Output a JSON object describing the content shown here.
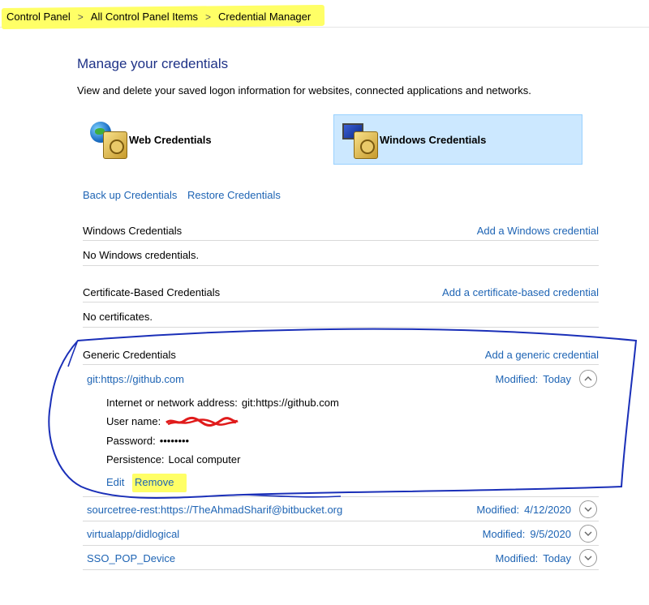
{
  "breadcrumb": {
    "items": [
      "Control Panel",
      "All Control Panel Items",
      "Credential Manager"
    ],
    "separator": ">"
  },
  "page": {
    "title": "Manage your credentials",
    "description": "View and delete your saved logon information for websites, connected applications and networks."
  },
  "tiles": {
    "web": {
      "label": "Web Credentials",
      "icon": "globe-vault-icon"
    },
    "windows": {
      "label": "Windows Credentials",
      "icon": "monitor-vault-icon",
      "selected": true
    }
  },
  "links": {
    "backup": "Back up Credentials",
    "restore": "Restore Credentials"
  },
  "sections": {
    "windows": {
      "title": "Windows Credentials",
      "add": "Add a Windows credential",
      "empty": "No Windows credentials."
    },
    "certificate": {
      "title": "Certificate-Based Credentials",
      "add": "Add a certificate-based credential",
      "empty": "No certificates."
    },
    "generic": {
      "title": "Generic Credentials",
      "add": "Add a generic credential"
    }
  },
  "generic_credentials": [
    {
      "name": "git:https://github.com",
      "modified_label": "Modified:",
      "modified": "Today",
      "expanded": true,
      "details": {
        "address_label": "Internet or network address:",
        "address": "git:https://github.com",
        "username_label": "User name:",
        "password_label": "Password:",
        "password": "••••••••",
        "persistence_label": "Persistence:",
        "persistence": "Local computer"
      },
      "edit": "Edit",
      "remove": "Remove"
    },
    {
      "name": "sourcetree-rest:https://TheAhmadSharif@bitbucket.org",
      "modified_label": "Modified:",
      "modified": "4/12/2020",
      "expanded": false
    },
    {
      "name": "virtualapp/didlogical",
      "modified_label": "Modified:",
      "modified": "9/5/2020",
      "expanded": false
    },
    {
      "name": "SSO_POP_Device",
      "modified_label": "Modified:",
      "modified": "Today",
      "expanded": false
    }
  ],
  "colors": {
    "link": "#1e64b4",
    "title": "#1e3287",
    "tile_selected": "#cce8ff",
    "highlight": "#ffff66",
    "annotation_pen": "#1a2fb8",
    "redaction": "#e01b1b"
  }
}
